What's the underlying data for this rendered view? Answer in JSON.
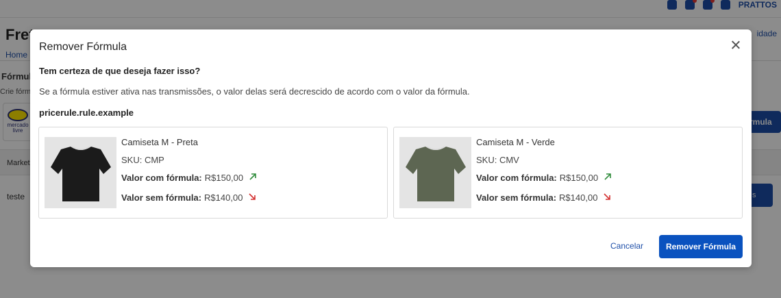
{
  "topbar": {
    "brand": "PRATTOS"
  },
  "background": {
    "page_title": "Fret",
    "header_link": "idade",
    "breadcrumb": "Home",
    "section_title": "Fórmula",
    "section_subtitle": "Crie fórm",
    "marketplace_logo_text": "mercado livre",
    "add_button": "rmula",
    "table_header": "Market",
    "row_value": "teste",
    "row_button": "s"
  },
  "modal": {
    "title": "Remover Fórmula",
    "question": "Tem certeza de que deseja fazer isso?",
    "description": "Se a fórmula estiver ativa nas transmissões, o valor delas será decrescido de acordo com o valor da fórmula.",
    "rule_name": "pricerule.rule.example",
    "products": [
      {
        "name": "Camiseta M - Preta",
        "sku_label": "SKU:",
        "sku": "CMP",
        "with_label": "Valor com fórmula:",
        "with_value": "R$150,00",
        "without_label": "Valor sem fórmula:",
        "without_value": "R$140,00",
        "shirt_color": "#1b1b1b"
      },
      {
        "name": "Camiseta M - Verde",
        "sku_label": "SKU:",
        "sku": "CMV",
        "with_label": "Valor com fórmula:",
        "with_value": "R$150,00",
        "without_label": "Valor sem fórmula:",
        "without_value": "R$140,00",
        "shirt_color": "#5d6652"
      }
    ],
    "cancel_label": "Cancelar",
    "confirm_label": "Remover Fórmula"
  },
  "colors": {
    "accent": "#0a52bf",
    "up_arrow": "#2e8b3a",
    "down_arrow": "#d32f2f"
  }
}
